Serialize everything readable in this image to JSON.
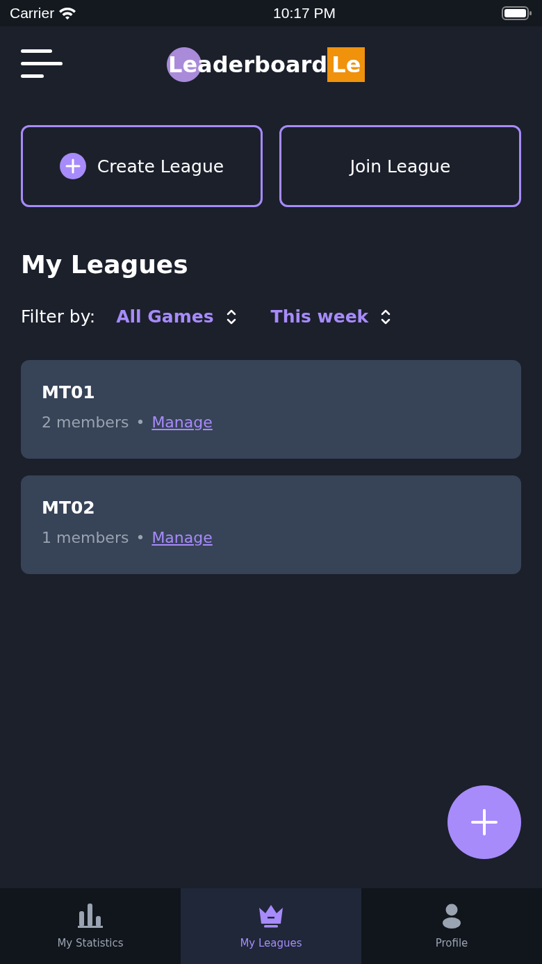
{
  "status_bar": {
    "carrier": "Carrier",
    "time": "10:17 PM"
  },
  "header": {
    "logo_main": "Leaderboard",
    "logo_suffix": "Le"
  },
  "actions": [
    {
      "label": "Create League",
      "kind": "create"
    },
    {
      "label": "Join League",
      "kind": "join"
    }
  ],
  "section_title": "My Leagues",
  "filter": {
    "label": "Filter by:",
    "options": [
      "All Games",
      "This week"
    ]
  },
  "leagues": [
    {
      "name": "MT01",
      "members": "2 members",
      "separator": "•",
      "link": "Manage"
    },
    {
      "name": "MT02",
      "members": "1 members",
      "separator": "•",
      "link": "Manage"
    }
  ],
  "tabs": [
    {
      "label": "My Statistics",
      "kind": "stats",
      "selected": false
    },
    {
      "label": "My Leagues",
      "kind": "leagues",
      "selected": true
    },
    {
      "label": "Profile",
      "kind": "profile",
      "selected": false
    }
  ]
}
